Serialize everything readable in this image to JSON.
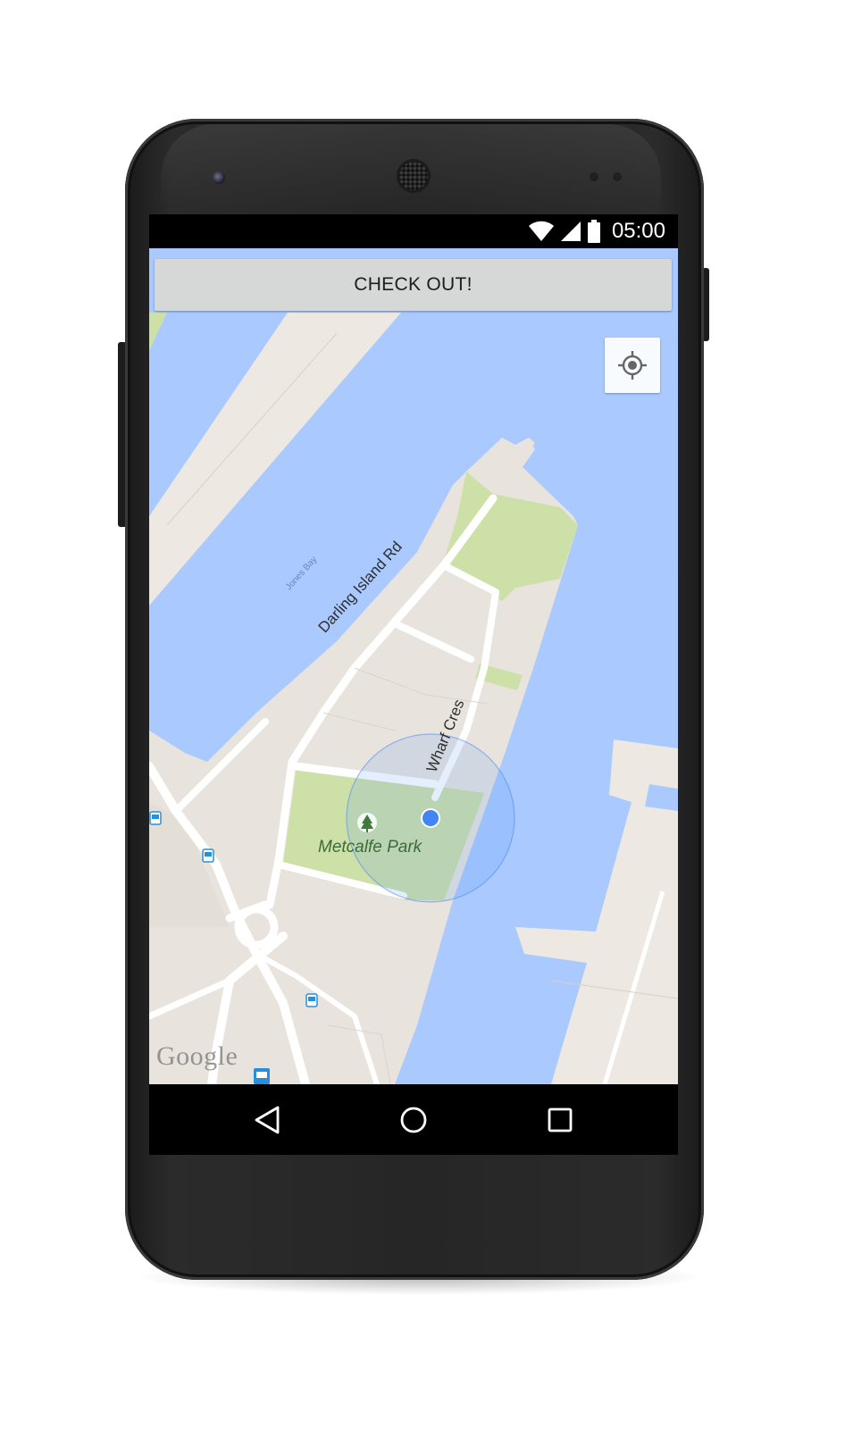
{
  "status_bar": {
    "time": "05:00",
    "icons": [
      "wifi-icon",
      "signal-icon",
      "battery-icon"
    ]
  },
  "toolbar": {
    "checkout_label": "CHECK OUT!"
  },
  "map": {
    "my_location_icon": "my-location-icon",
    "labels": {
      "road_darling": "Darling Island Rd",
      "road_wharf": "Wharf Cres",
      "bay": "Jones Bay",
      "park": "Metcalfe Park"
    },
    "attribution": "Google",
    "markers": [
      "tree-icon",
      "bus-stop-icon",
      "bus-stop-icon",
      "bus-stop-icon",
      "tram-stop-icon"
    ],
    "colors": {
      "water": "#a9c9ff",
      "land": "#e8e4dd",
      "pier": "#ede9e2",
      "park": "#cde0a8",
      "road": "#ffffff",
      "location_dot": "#4285f4",
      "accuracy_fill": "#4a8af4"
    }
  },
  "navigation_bar": {
    "icons": [
      "back-icon",
      "home-icon",
      "recents-icon"
    ]
  }
}
